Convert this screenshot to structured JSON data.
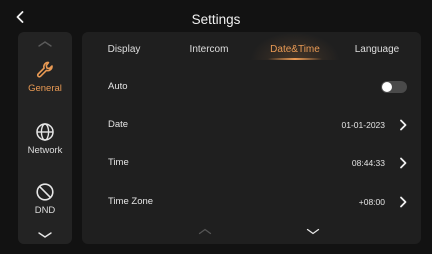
{
  "header": {
    "title": "Settings"
  },
  "sidebar": {
    "items": [
      {
        "label": "General",
        "icon": "wrench-icon",
        "active": true
      },
      {
        "label": "Network",
        "icon": "globe-icon",
        "active": false
      },
      {
        "label": "DND",
        "icon": "block-icon",
        "active": false
      }
    ]
  },
  "tabs": [
    {
      "label": "Display",
      "active": false
    },
    {
      "label": "Intercom",
      "active": false
    },
    {
      "label": "Date&Time",
      "active": true
    },
    {
      "label": "Language",
      "active": false
    }
  ],
  "settings": {
    "auto": {
      "label": "Auto",
      "toggle_on": false
    },
    "date": {
      "label": "Date",
      "value": "01-01-2023"
    },
    "time": {
      "label": "Time",
      "value": "08:44:33"
    },
    "timezone": {
      "label": "Time Zone",
      "value": "+08:00"
    }
  },
  "colors": {
    "accent": "#e99a54",
    "background": "#121212",
    "panel": "#1f1f1f",
    "sidebar": "#232323"
  }
}
